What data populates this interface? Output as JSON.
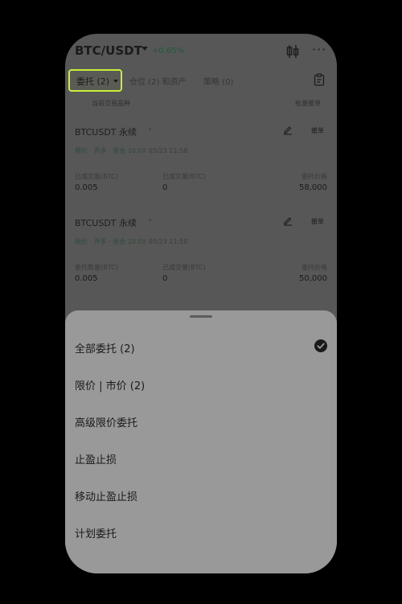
{
  "header": {
    "pair": "BTC/USDT",
    "change": "+0.65%",
    "icons": [
      "chevron-down-icon",
      "candlestick-icon",
      "more-icon"
    ]
  },
  "tabs": {
    "orders": "委托 (2)",
    "positions": "仓位 (2) 和资产",
    "strategies": "策略 (0)"
  },
  "sub": {
    "left": "当前交易品种",
    "right": "批量撤单"
  },
  "orders": [
    {
      "name": "BTCUSDT 永续",
      "tags": "限价 · 开多 · 逐仓 10.0X",
      "time": "05/23 11:58",
      "cancel": "撤单",
      "col1_label": "已成交量(BTC)",
      "col1_value": "0.005",
      "col2_label": "已成交量(BTC)",
      "col2_value": "0",
      "col3_label": "委托价格",
      "col3_value": "58,000"
    },
    {
      "name": "BTCUSDT 永续",
      "tags": "限价 · 开多 · 逐仓 10.0X",
      "time": "05/23 11:58",
      "cancel": "撤单",
      "col1_label": "委托数量(BTC)",
      "col1_value": "0.005",
      "col2_label": "已成交量(BTC)",
      "col2_value": "0",
      "col3_label": "委托价格",
      "col3_value": "50,000"
    }
  ],
  "sheet": {
    "options": [
      "全部委托 (2)",
      "限价 | 市价 (2)",
      "高级限价委托",
      "止盈止损",
      "移动止盈止损",
      "计划委托"
    ],
    "selected_index": 0
  },
  "colors": {
    "highlight": "#c6ef3a",
    "overlay": "#575757",
    "sheet": "#999999"
  }
}
